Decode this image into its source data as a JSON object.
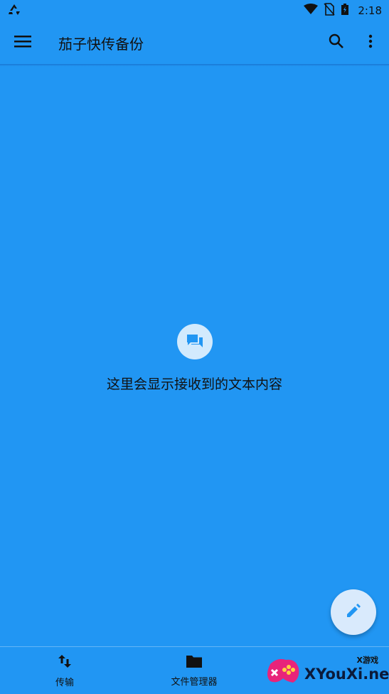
{
  "status_bar": {
    "time": "2:18",
    "icons": [
      "recycle-icon",
      "wifi-icon",
      "no-sim-icon",
      "battery-icon"
    ]
  },
  "app_bar": {
    "title": "茄子快传备份",
    "icons": [
      "menu-icon",
      "search-icon",
      "more-vert-icon"
    ]
  },
  "empty_state": {
    "icon": "chat-bubbles-icon",
    "text": "这里会显示接收到的文本内容"
  },
  "fab": {
    "icon": "edit-pencil-icon"
  },
  "bottom_nav": {
    "items": [
      {
        "label": "传输",
        "icon": "swap-vert-icon"
      },
      {
        "label": "文件管理器",
        "icon": "folder-icon"
      }
    ]
  },
  "watermark": {
    "small_text": "X游戏",
    "text": "XYouXi.net",
    "icon": "gamepad-logo-icon"
  },
  "colors": {
    "background": "#2196f3",
    "text": "#111111",
    "fab": "#d9eafc"
  }
}
